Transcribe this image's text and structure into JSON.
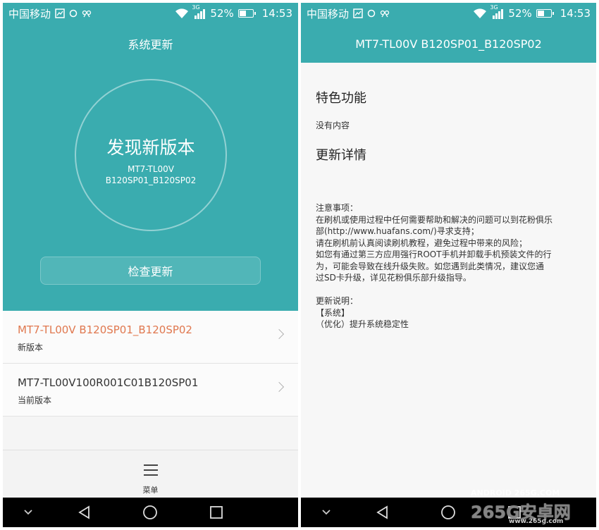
{
  "status_bar": {
    "carrier": "中国移动",
    "network": "3G",
    "battery": "52%",
    "battery_level": 0.52,
    "time": "14:53"
  },
  "left_screen": {
    "title": "系统更新",
    "circle": {
      "title": "发现新版本",
      "model": "MT7-TL00V",
      "build": "B120SP01_B120SP02"
    },
    "check_button": "检查更新",
    "versions": [
      {
        "name": "MT7-TL00V B120SP01_B120SP02",
        "label": "新版本"
      },
      {
        "name": "MT7-TL00V100R001C01B120SP01",
        "label": "当前版本"
      }
    ],
    "menu_label": "菜单"
  },
  "right_screen": {
    "title": "MT7-TL00V B120SP01_B120SP02",
    "features_heading": "特色功能",
    "features_text": "没有内容",
    "details_heading": "更新详情",
    "notes_lines": [
      "注意事项：",
      "在刷机或使用过程中任何需要帮助和解决的问题可以到花粉俱乐",
      "部(http://www.huafans.com/)寻求支持；",
      "请在刷机前认真阅读刷机教程，避免过程中带来的风险；",
      "如您有通过第三方应用强行ROOT手机并卸载手机预装文件的行",
      "为，可能会导致在线升级失败。如您遇到此类情况，建议您通",
      "过SD卡升级，详见花粉俱乐部升级指导。"
    ],
    "changes_lines": [
      "更新说明：",
      "【系统】",
      "（优化）提升系统稳定性"
    ]
  },
  "icons": {
    "signal": "cellular-signal-icon",
    "wifi": "wifi-icon",
    "battery": "battery-icon",
    "back": "back-triangle-icon",
    "home": "home-circle-icon",
    "recents": "recents-square-icon",
    "collapse": "chevron-down-icon",
    "menu": "hamburger-menu-icon"
  },
  "colors": {
    "primary": "#3aacaf",
    "accent": "#e0784f"
  },
  "watermark": {
    "small": "ANDROID 265G.COM",
    "big": "265G安卓网",
    "url": "www.265g.com"
  }
}
